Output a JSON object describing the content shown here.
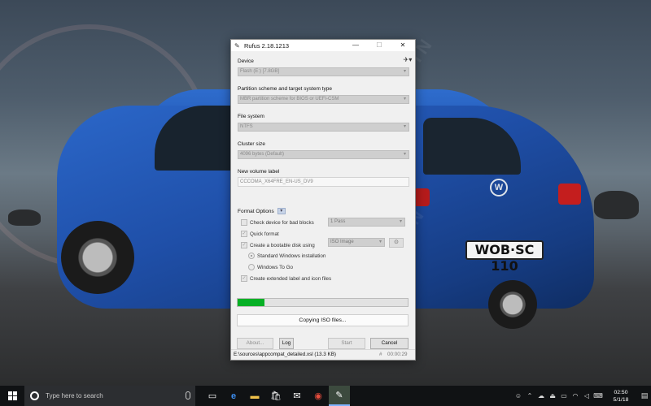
{
  "window": {
    "title": "Rufus 2.18.1213",
    "minimize": "—",
    "maximize": "☐",
    "close": "✕"
  },
  "device": {
    "label": "Device",
    "value": "Flash (E:) [7.8GB]"
  },
  "partition": {
    "label": "Partition scheme and target system type",
    "value": "MBR partition scheme for BIOS or UEFI-CSM"
  },
  "filesystem": {
    "label": "File system",
    "value": "NTFS"
  },
  "cluster": {
    "label": "Cluster size",
    "value": "4096 bytes (Default)"
  },
  "volume": {
    "label": "New volume label",
    "value": "CCCOMA_X64FRE_EN-US_DV9"
  },
  "format_options": {
    "header": "Format Options",
    "toggle": "▾",
    "bad_blocks_label": "Check device for bad blocks",
    "bad_blocks_checked": false,
    "passes_value": "1 Pass",
    "quick_format_label": "Quick format",
    "quick_format_checked": true,
    "bootable_label": "Create a bootable disk using",
    "bootable_checked": true,
    "bootable_type": "ISO Image",
    "standard_install_label": "Standard Windows installation",
    "standard_install_selected": true,
    "windows_to_go_label": "Windows To Go",
    "extended_label_label": "Create extended label and icon files",
    "extended_label_checked": true
  },
  "progress": {
    "fraction": 0.16,
    "status": "Copying ISO files..."
  },
  "buttons": {
    "about": "About...",
    "log": "Log",
    "start": "Start",
    "cancel": "Cancel"
  },
  "statusbar": {
    "file": "E:\\sources\\appcompat_detailed.xsl (13.3 KB)",
    "hash": "#",
    "elapsed": "00:00:29"
  },
  "taskbar": {
    "search_placeholder": "Type here to search",
    "time": "02:50",
    "date": "5/1/18"
  },
  "wallpaper": {
    "plate": "WOB·SC 110",
    "watermark": "WINPOIN"
  },
  "colors": {
    "progress": "#06b025",
    "car_blue": "#1f4fa8",
    "taskbar": "#101214"
  }
}
